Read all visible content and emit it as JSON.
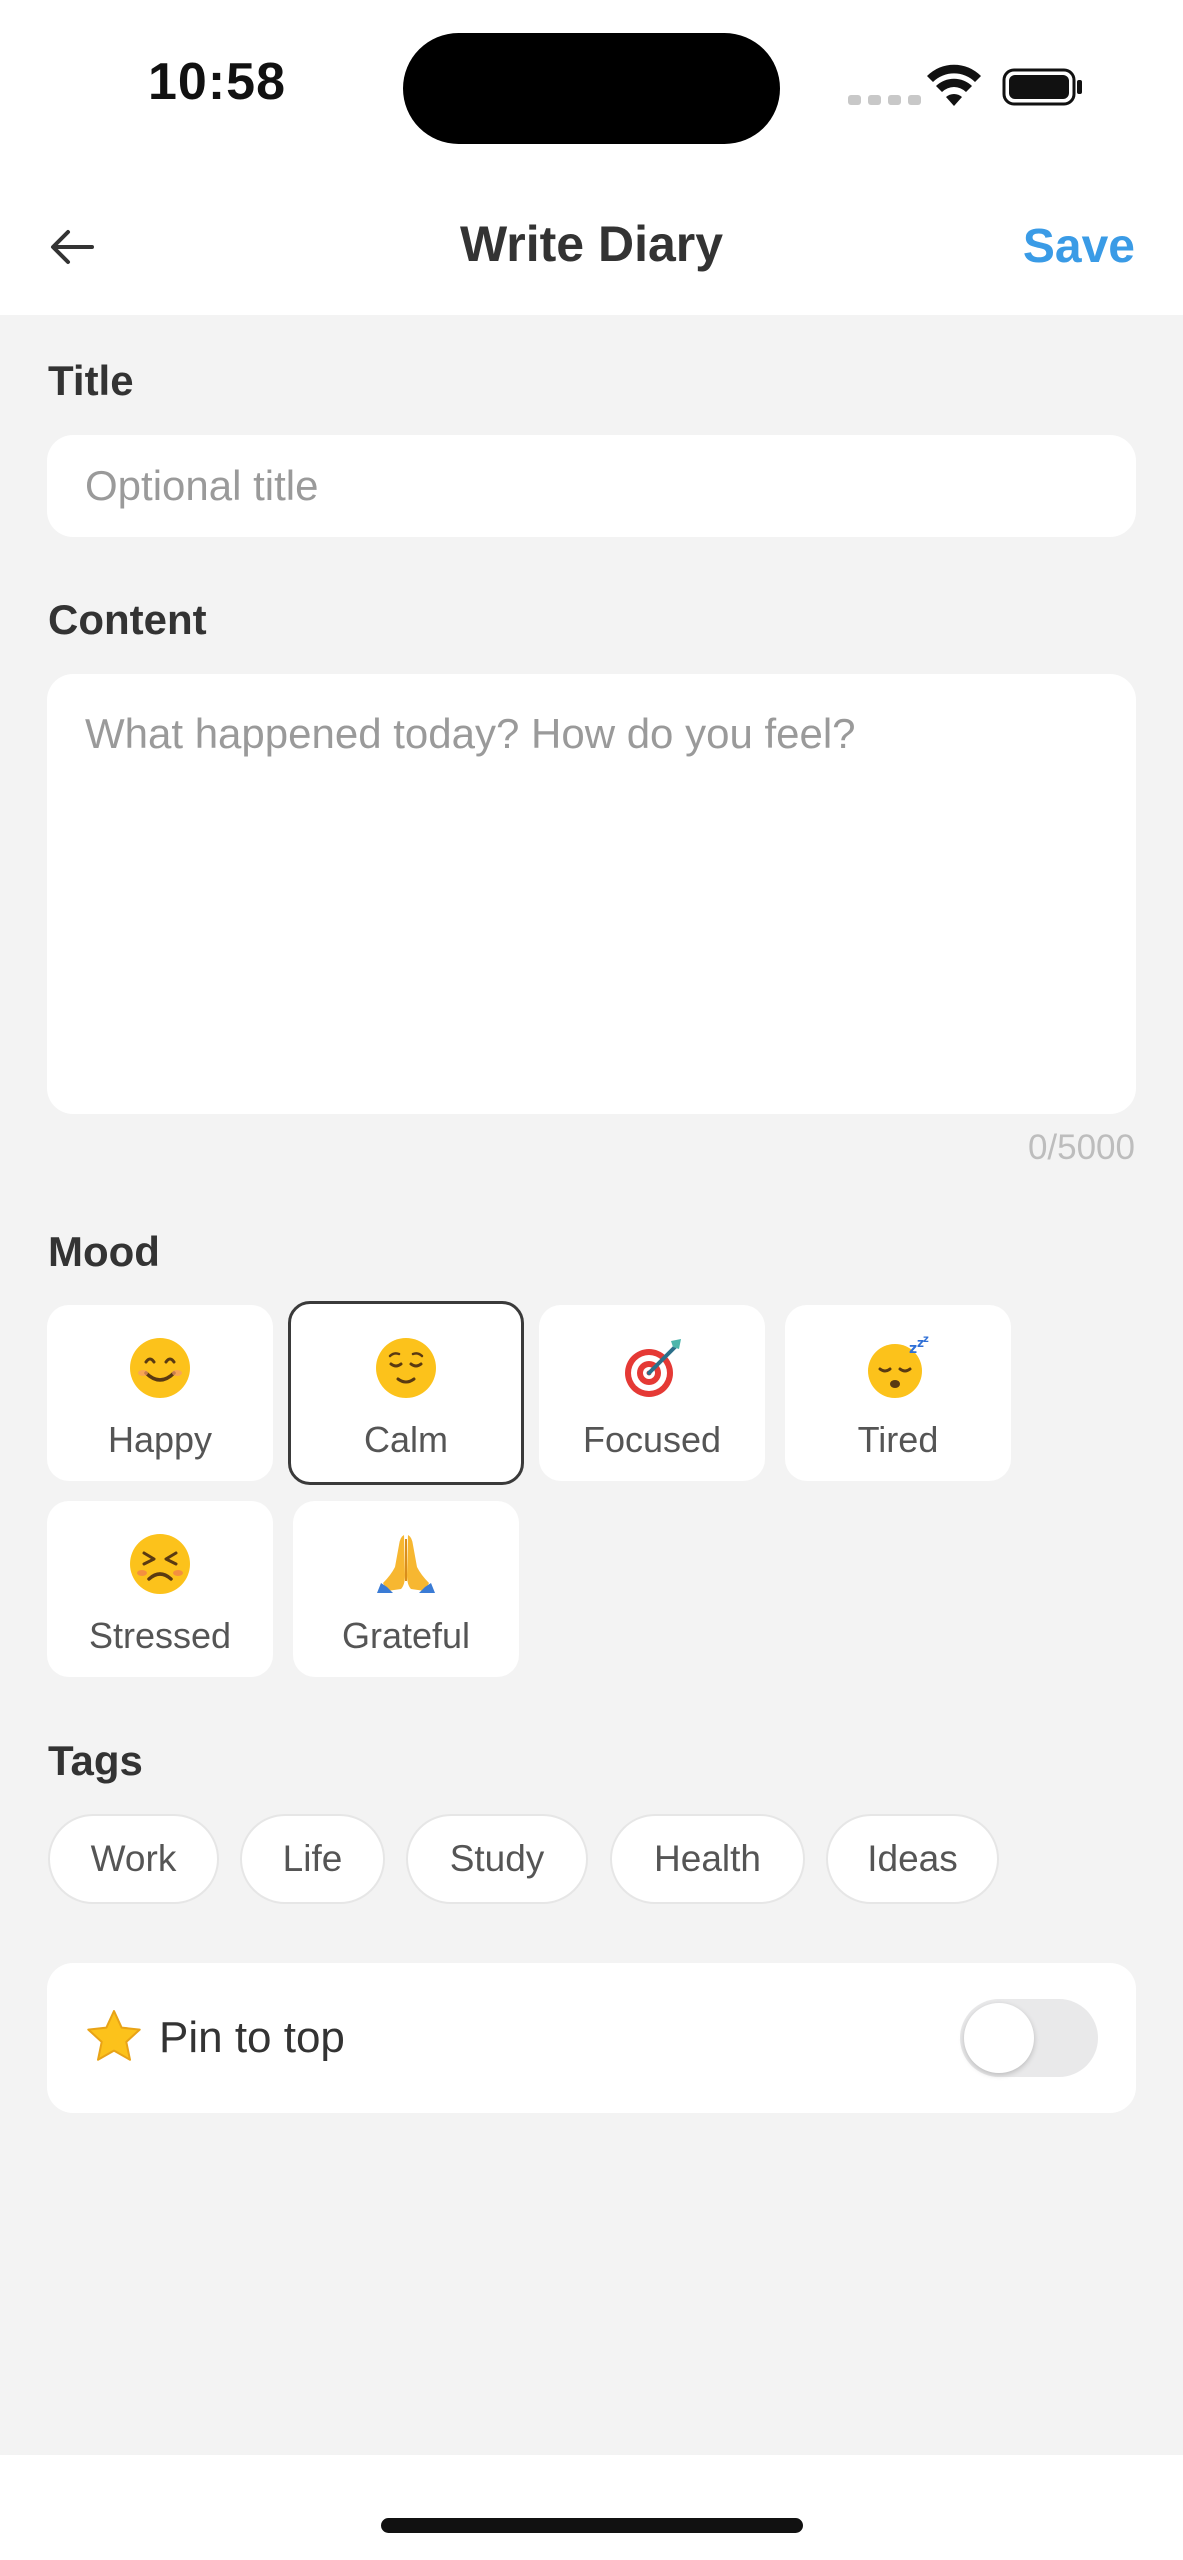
{
  "status_bar": {
    "time": "10:58"
  },
  "header": {
    "title": "Write Diary",
    "save_label": "Save",
    "back_icon": "arrow-left-icon"
  },
  "form": {
    "title_label": "Title",
    "title_placeholder": "Optional title",
    "title_value": "",
    "content_label": "Content",
    "content_placeholder": "What happened today? How do you feel?",
    "content_value": "",
    "char_count": "0/5000"
  },
  "mood": {
    "label": "Mood",
    "selected": "Calm",
    "options": [
      {
        "label": "Happy",
        "icon": "smiling-face-icon"
      },
      {
        "label": "Calm",
        "icon": "relieved-face-icon"
      },
      {
        "label": "Focused",
        "icon": "target-icon"
      },
      {
        "label": "Tired",
        "icon": "sleeping-face-icon"
      },
      {
        "label": "Stressed",
        "icon": "persevering-face-icon"
      },
      {
        "label": "Grateful",
        "icon": "folded-hands-icon"
      }
    ]
  },
  "tags": {
    "label": "Tags",
    "items": [
      "Work",
      "Life",
      "Study",
      "Health",
      "Ideas"
    ]
  },
  "pin": {
    "label": "Pin to top",
    "icon": "star-icon",
    "enabled": false
  },
  "colors": {
    "accent": "#3a9be6",
    "background": "#f3f3f3",
    "card": "#ffffff",
    "selected_border": "#3a3a3a"
  }
}
